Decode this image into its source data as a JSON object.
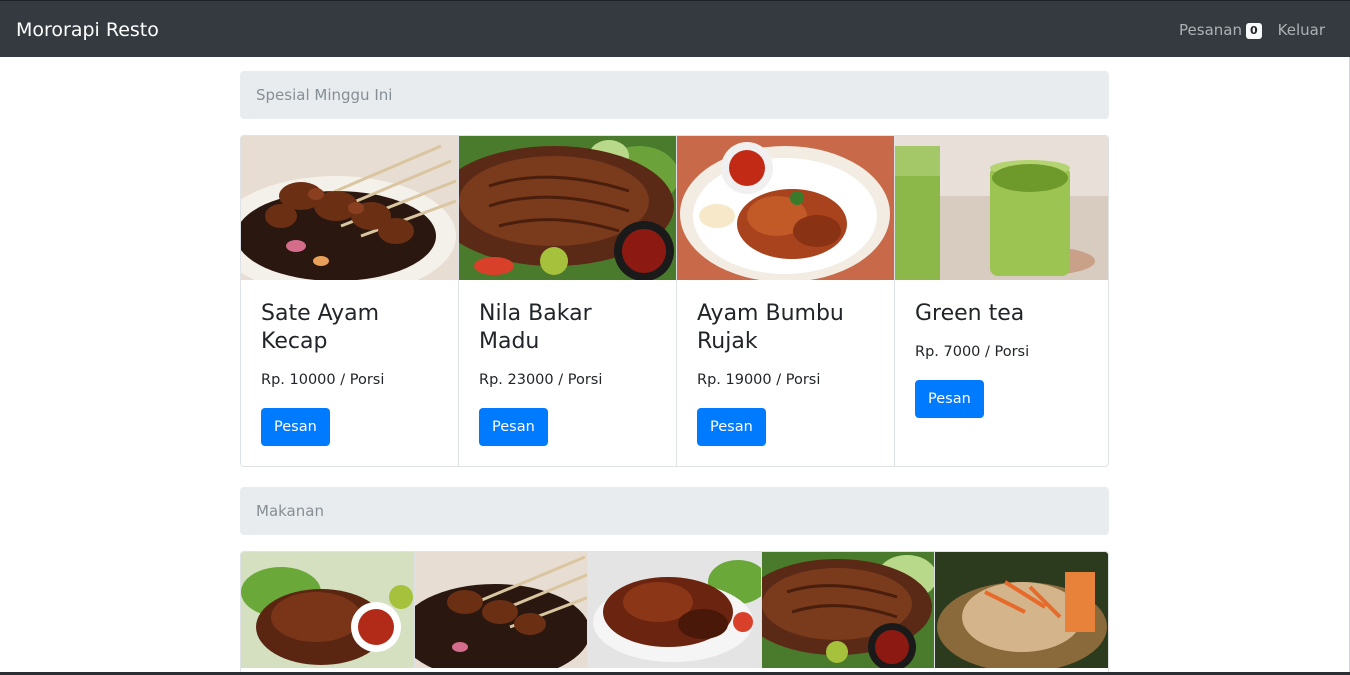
{
  "navbar": {
    "brand": "Mororapi Resto",
    "orders_label": "Pesanan",
    "orders_count": "0",
    "logout_label": "Keluar"
  },
  "special_section": {
    "title": "Spesial Minggu Ini",
    "items": [
      {
        "name": "Sate Ayam Kecap",
        "price": "Rp. 10000 / Porsi",
        "button": "Pesan",
        "image": "sate-ayam-photo"
      },
      {
        "name": "Nila Bakar Madu",
        "price": "Rp. 23000 / Porsi",
        "button": "Pesan",
        "image": "grilled-fish-photo"
      },
      {
        "name": "Ayam Bumbu Rujak",
        "price": "Rp. 19000 / Porsi",
        "button": "Pesan",
        "image": "grilled-chicken-photo"
      },
      {
        "name": "Green tea",
        "price": "Rp. 7000 / Porsi",
        "button": "Pesan",
        "image": "green-tea-photo"
      }
    ]
  },
  "food_section": {
    "title": "Makanan",
    "items": [
      {
        "image": "roast-duck-photo"
      },
      {
        "image": "sate-ayam-photo"
      },
      {
        "image": "grilled-chicken-photo"
      },
      {
        "image": "grilled-fish-photo"
      },
      {
        "image": "fried-fish-photo"
      }
    ]
  },
  "colors": {
    "navbar_bg": "#343a40",
    "primary_button": "#007bff",
    "section_header_bg": "#e9ecef"
  }
}
